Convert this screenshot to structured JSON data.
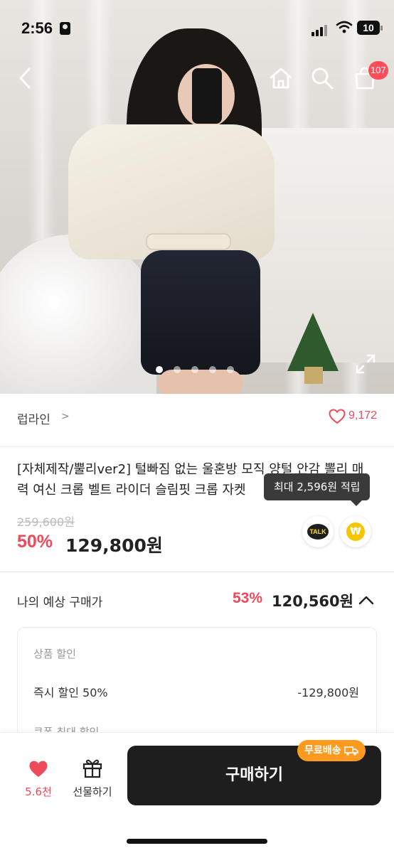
{
  "status_bar": {
    "time": "2:56",
    "battery": "10"
  },
  "header": {
    "cart_count": "107"
  },
  "gallery": {
    "total_images": 5,
    "active_index": 0
  },
  "brand": {
    "name": "럽라인",
    "arrow": ">",
    "like_count": "9,172"
  },
  "product": {
    "title": "[자체제작/뿔리ver2] 털빠짐 없는 울혼방 모직 양털 안감 뽈리 매력 여신 크롭 벨트 라이더 슬림핏 크롭 자켓",
    "points_tooltip": "최대 2,596원 적립",
    "original_price": "259,600원",
    "discount_rate": "50%",
    "sale_price": "129,800원",
    "talk_label": "TALK",
    "won_symbol": "₩"
  },
  "my_price": {
    "label": "나의 예상 구매가",
    "discount_rate": "53%",
    "price": "120,560원"
  },
  "discount_detail": {
    "section": "상품 할인",
    "row_label": "즉시 할인 50%",
    "row_value": "-129,800원",
    "section2": "쿠폰 최대 할인"
  },
  "bottom_bar": {
    "wish_count": "5.6천",
    "gift_label": "선물하기",
    "buy_label": "구매하기",
    "free_shipping": "무료배송"
  },
  "colors": {
    "accent": "#ef4a5a",
    "buy_button": "#1e1e1e",
    "free_shipping_badge": "#ff9a1f"
  }
}
